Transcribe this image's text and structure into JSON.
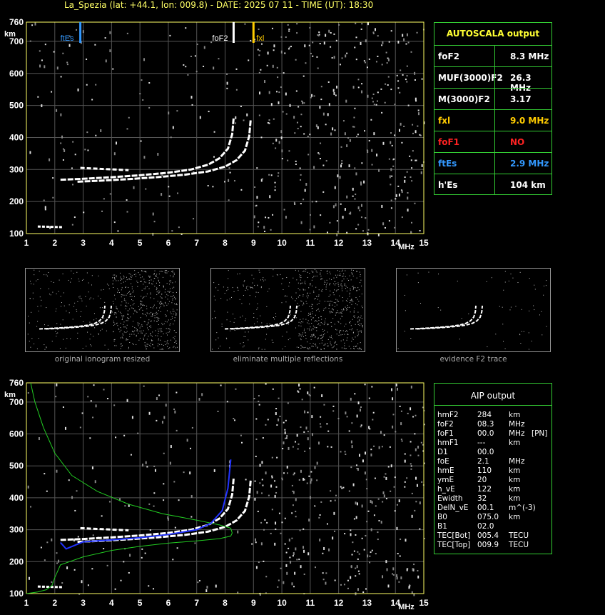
{
  "header": {
    "title": "La_Spezia (lat: +44.1, lon: 009.8) - DATE: 2025 07 11 - TIME (UT): 18:30"
  },
  "colors": {
    "axis": "#ffff66",
    "trace": "#ffffff",
    "noise": "#aaaaaa",
    "model": "#22cc22",
    "fit": "#2233ff",
    "fte": "#3399ff",
    "fxl": "#ffcc00",
    "red": "#ff2222",
    "panel": "#33cc33"
  },
  "markers": {
    "ftEs": "ftEs",
    "foF2": "foF2",
    "fxl": "fxl"
  },
  "autoscala": {
    "title": "AUTOSCALA output",
    "rows": [
      {
        "key": "foF2",
        "value": "8.3 MHz",
        "color": "#ffffff"
      },
      {
        "key": "MUF(3000)F2",
        "value": "26.3 MHz",
        "color": "#ffffff"
      },
      {
        "key": "M(3000)F2",
        "value": "3.17",
        "color": "#ffffff"
      },
      {
        "key": "fxl",
        "value": "9.0 MHz",
        "color": "#ffcc00"
      },
      {
        "key": "foF1",
        "value": "NO",
        "color": "#ff2222"
      },
      {
        "key": "ftEs",
        "value": "2.9 MHz",
        "color": "#3399ff"
      },
      {
        "key": "h'Es",
        "value": "104     km",
        "color": "#ffffff"
      }
    ]
  },
  "aip": {
    "title": "AIP output",
    "rows": [
      [
        "hmF2",
        "284",
        "km",
        ""
      ],
      [
        "foF2",
        "08.3",
        "MHz",
        ""
      ],
      [
        "foF1",
        "00.0",
        "MHz",
        "[PN]"
      ],
      [
        "hmF1",
        "---",
        "km",
        ""
      ],
      [
        "D1",
        "00.0",
        "",
        ""
      ],
      [
        "foE",
        "2.1",
        "MHz",
        ""
      ],
      [
        "hmE",
        "110",
        "km",
        ""
      ],
      [
        "ymE",
        "20",
        "km",
        ""
      ],
      [
        "h_vE",
        "122",
        "km",
        ""
      ],
      [
        "Ewidth",
        "32",
        "km",
        ""
      ],
      [
        "DelN_vE",
        "00.1",
        "m^(-3)",
        ""
      ],
      [
        "B0",
        "075.0",
        "km",
        ""
      ],
      [
        "B1",
        "02.0",
        "",
        ""
      ],
      [
        "TEC[Bot]",
        "005.4",
        "TECU",
        ""
      ],
      [
        "TEC[Top]",
        "009.9",
        "TECU",
        ""
      ]
    ]
  },
  "thumbnails": [
    {
      "caption": "original ionogram resized"
    },
    {
      "caption": "eliminate multiple reflections"
    },
    {
      "caption": "evidence F2 trace"
    }
  ],
  "chart_data": [
    {
      "type": "scatter",
      "title": "La_Spezia (lat: +44.1, lon: 009.8) - DATE: 2025 07 11 - TIME (UT): 18:30",
      "xlabel": "MHz",
      "ylabel": "km",
      "xlim": [
        1,
        15
      ],
      "ylim": [
        100,
        760
      ],
      "xticks": [
        1,
        2,
        3,
        4,
        5,
        6,
        7,
        8,
        9,
        10,
        11,
        12,
        13,
        14,
        15
      ],
      "yticks": [
        100,
        200,
        300,
        400,
        500,
        600,
        700,
        760
      ],
      "vlines": [
        {
          "name": "ftEs",
          "x": 2.9
        },
        {
          "name": "foF2",
          "x": 8.3
        },
        {
          "name": "fxl",
          "x": 9.0
        }
      ],
      "grid": true
    },
    {
      "type": "line",
      "title": "AIP output",
      "xlabel": "MHz",
      "ylabel": "km",
      "xlim": [
        1,
        15
      ],
      "ylim": [
        100,
        760
      ],
      "xticks": [
        1,
        2,
        3,
        4,
        5,
        6,
        7,
        8,
        9,
        10,
        11,
        12,
        13,
        14,
        15
      ],
      "yticks": [
        100,
        200,
        300,
        400,
        500,
        600,
        700,
        760
      ],
      "grid": true,
      "series": [
        {
          "x": [
            1.15,
            1.3,
            1.6,
            2.0,
            2.6,
            3.5,
            4.6,
            5.8,
            7.0,
            7.8,
            8.2,
            8.25,
            8.2,
            7.8,
            7.0,
            6.0,
            5.0,
            4.0,
            3.0,
            2.2,
            2.0,
            1.9,
            1.7,
            1.4,
            1.0
          ],
          "y": [
            760,
            700,
            620,
            540,
            470,
            420,
            380,
            350,
            330,
            315,
            305,
            290,
            280,
            272,
            265,
            258,
            248,
            235,
            215,
            190,
            150,
            125,
            112,
            105,
            100
          ]
        },
        {
          "x": [
            2.2,
            2.4,
            3,
            4,
            5,
            6,
            7,
            7.5,
            7.9,
            8.1,
            8.2
          ],
          "y": [
            260,
            240,
            262,
            268,
            275,
            285,
            300,
            320,
            360,
            430,
            520
          ]
        }
      ]
    }
  ]
}
